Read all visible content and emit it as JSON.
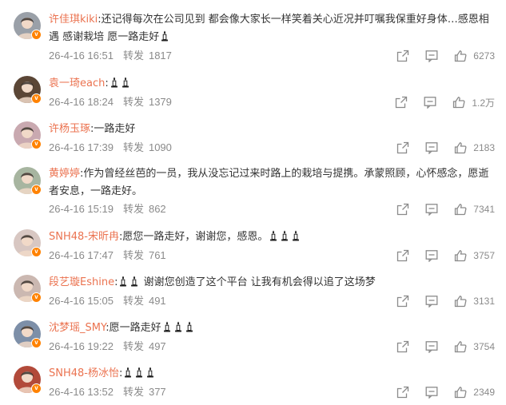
{
  "comments": [
    {
      "user": "许佳琪kiki",
      "text": ":还记得每次在公司见到 都会像大家长一样笑着关心近况并叮嘱我保重好身体…感恩相遇 感谢栽培 愿一路走好",
      "candles": 1,
      "date": "26-4-16 16:51",
      "fwd_label": "转发",
      "fwd": "1817",
      "likes": "6273",
      "avatar_color": "#9aa0a8"
    },
    {
      "user": "袁一琦each",
      "text": ":",
      "candles": 2,
      "date": "26-4-16 18:24",
      "fwd_label": "转发",
      "fwd": "1379",
      "likes": "1.2万",
      "avatar_color": "#5b4636"
    },
    {
      "user": "许杨玉琢",
      "text": ":一路走好",
      "candles": 0,
      "date": "26-4-16 17:39",
      "fwd_label": "转发",
      "fwd": "1090",
      "likes": "2183",
      "avatar_color": "#c9a9b0"
    },
    {
      "user": "黄婷婷",
      "text": ":作为曾经丝芭的一员，我从没忘记过来时路上的栽培与提携。承蒙照顾，心怀感念，愿逝者安息，一路走好。",
      "candles": 0,
      "date": "26-4-16 15:19",
      "fwd_label": "转发",
      "fwd": "862",
      "likes": "7341",
      "avatar_color": "#a7b5a0"
    },
    {
      "user": "SNH48-宋昕冉",
      "text": ":愿您一路走好，谢谢您，感恩。",
      "candles": 3,
      "date": "26-4-16 17:47",
      "fwd_label": "转发",
      "fwd": "761",
      "likes": "3757",
      "avatar_color": "#d8c7c2"
    },
    {
      "user": "段艺璇Eshine",
      "text": ":",
      "candles": 2,
      "text2": " 谢谢您创造了这个平台 让我有机会得以追了这场梦",
      "date": "26-4-16 15:05",
      "fwd_label": "转发",
      "fwd": "491",
      "likes": "3131",
      "avatar_color": "#cbb8b1"
    },
    {
      "user": "沈梦瑶_SMY",
      "text": ":愿一路走好",
      "candles": 3,
      "date": "26-4-16 19:22",
      "fwd_label": "转发",
      "fwd": "497",
      "likes": "3754",
      "avatar_color": "#7d8fa8"
    },
    {
      "user": "SNH48-杨冰怡",
      "text": ":",
      "candles": 3,
      "date": "26-4-16 13:52",
      "fwd_label": "转发",
      "fwd": "377",
      "likes": "2349",
      "avatar_color": "#b24a3a"
    }
  ],
  "colors": {
    "username": "#eb7350",
    "meta": "#8a8a8a",
    "badge": "#ff8200"
  },
  "icons": {
    "share": "share-icon",
    "reply": "comment-icon",
    "like": "thumbs-up-icon",
    "candle": "candle-icon",
    "verified": "verified-badge-icon"
  }
}
